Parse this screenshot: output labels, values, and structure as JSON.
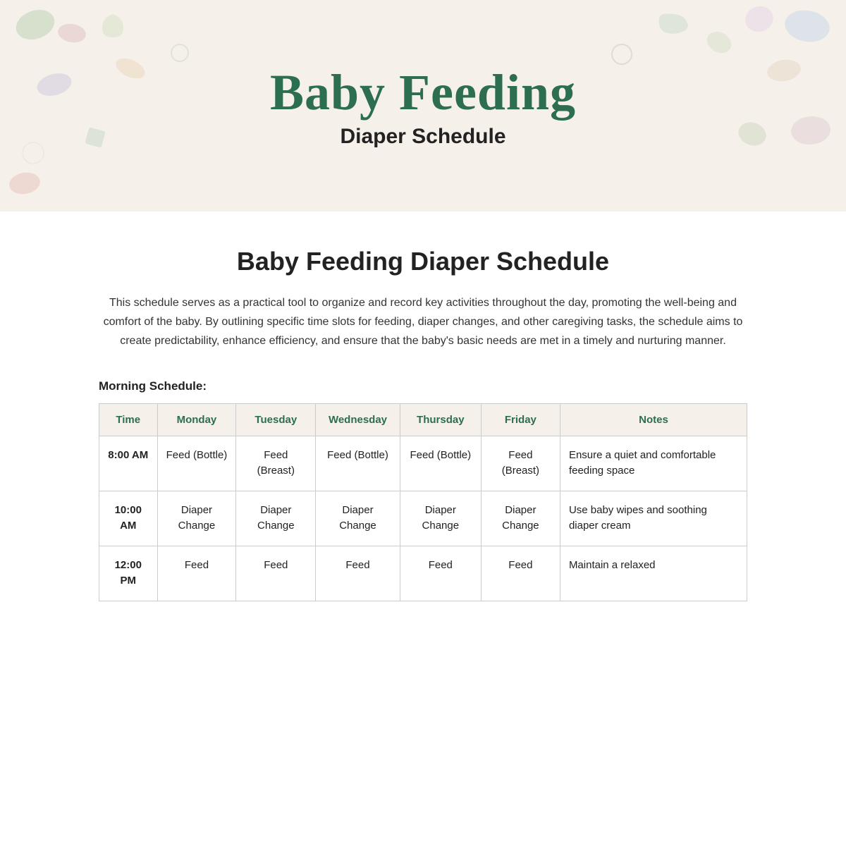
{
  "header": {
    "title": "Baby Feeding",
    "subtitle": "Diaper Schedule"
  },
  "page": {
    "title": "Baby Feeding Diaper Schedule",
    "description": "This schedule serves as a practical tool to organize and record key activities throughout the day, promoting the well-being and comfort of the baby. By outlining specific time slots for feeding, diaper changes, and other caregiving tasks, the schedule aims to create predictability, enhance efficiency, and ensure that the baby's basic needs are met in a timely and nurturing manner."
  },
  "morning_schedule": {
    "label": "Morning Schedule:",
    "columns": [
      "Time",
      "Monday",
      "Tuesday",
      "Wednesday",
      "Thursday",
      "Friday",
      "Notes"
    ],
    "rows": [
      {
        "time": "8:00 AM",
        "monday": "Feed (Bottle)",
        "tuesday": "Feed (Breast)",
        "wednesday": "Feed (Bottle)",
        "thursday": "Feed (Bottle)",
        "friday": "Feed (Breast)",
        "notes": "Ensure a quiet and comfortable feeding space"
      },
      {
        "time": "10:00 AM",
        "monday": "Diaper Change",
        "tuesday": "Diaper Change",
        "wednesday": "Diaper Change",
        "thursday": "Diaper Change",
        "friday": "Diaper Change",
        "notes": "Use baby wipes and soothing diaper cream"
      },
      {
        "time": "12:00 PM",
        "monday": "Feed",
        "tuesday": "Feed",
        "wednesday": "Feed",
        "thursday": "Feed",
        "friday": "Feed",
        "notes": "Maintain a relaxed"
      }
    ]
  }
}
